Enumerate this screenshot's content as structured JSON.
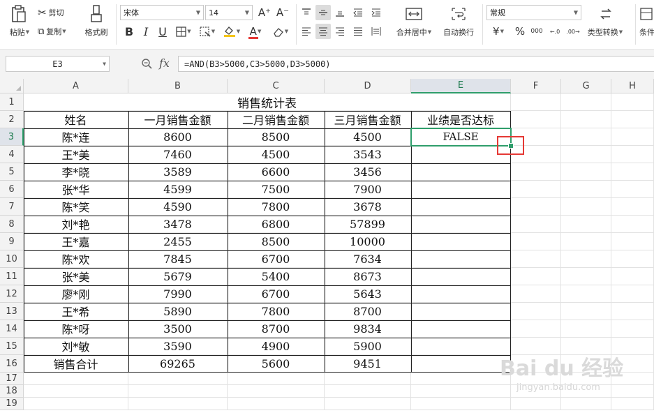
{
  "ribbon": {
    "paste_label": "粘贴",
    "cut_label": "剪切",
    "copy_label": "复制",
    "format_painter_label": "格式刷",
    "font_name": "宋体",
    "font_size": "14",
    "merge_center_label": "合并居中",
    "wrap_text_label": "自动换行",
    "number_format": "常规",
    "type_convert_label": "类型转换",
    "conditional_label": "条件",
    "grow_font_glyph": "A⁺",
    "shrink_font_glyph": "A⁻",
    "bold_glyph": "B",
    "italic_glyph": "I",
    "underline_glyph": "U",
    "currency_glyph": "¥",
    "percent_glyph": "%",
    "thousands_glyph": "000",
    "inc_decimal_glyph": "←.0",
    "dec_decimal_glyph": ".00→",
    "font_color_glyph": "A",
    "accent_green": "#2f9e6b",
    "font_color_red": "#e53935"
  },
  "formula_bar": {
    "name_box": "E3",
    "fx_label": "fx",
    "formula": "=AND(B3>5000,C3>5000,D3>5000)"
  },
  "columns": [
    "A",
    "B",
    "C",
    "D",
    "E",
    "F",
    "G",
    "H"
  ],
  "rows": [
    "1",
    "2",
    "3",
    "4",
    "5",
    "6",
    "7",
    "8",
    "9",
    "10",
    "11",
    "12",
    "13",
    "14",
    "15",
    "16",
    "17",
    "18",
    "19"
  ],
  "sheet": {
    "title": "销售统计表",
    "headers": [
      "姓名",
      "一月销售金额",
      "二月销售金额",
      "三月销售金额",
      "业绩是否达标"
    ],
    "data": [
      [
        "陈*连",
        "8600",
        "8500",
        "4500",
        "FALSE"
      ],
      [
        "王*美",
        "7460",
        "4500",
        "3543",
        ""
      ],
      [
        "李*晓",
        "3589",
        "6600",
        "3456",
        ""
      ],
      [
        "张*华",
        "4599",
        "7500",
        "7900",
        ""
      ],
      [
        "陈*笑",
        "4590",
        "7800",
        "3678",
        ""
      ],
      [
        "刘*艳",
        "3478",
        "6800",
        "57899",
        ""
      ],
      [
        "王*嘉",
        "2455",
        "8500",
        "10000",
        ""
      ],
      [
        "陈*欢",
        "7845",
        "6700",
        "7634",
        ""
      ],
      [
        "张*美",
        "5679",
        "5400",
        "8673",
        ""
      ],
      [
        "廖*刚",
        "7990",
        "6700",
        "5643",
        ""
      ],
      [
        "王*希",
        "5890",
        "7800",
        "8700",
        ""
      ],
      [
        "陈*呀",
        "3500",
        "8700",
        "9834",
        ""
      ],
      [
        "刘*敏",
        "3590",
        "4900",
        "5900",
        ""
      ],
      [
        "销售合计",
        "69265",
        "5600",
        "9451",
        ""
      ]
    ]
  },
  "watermark": {
    "brand": "Bai du 经验",
    "url": "jingyan.baidu.com"
  }
}
